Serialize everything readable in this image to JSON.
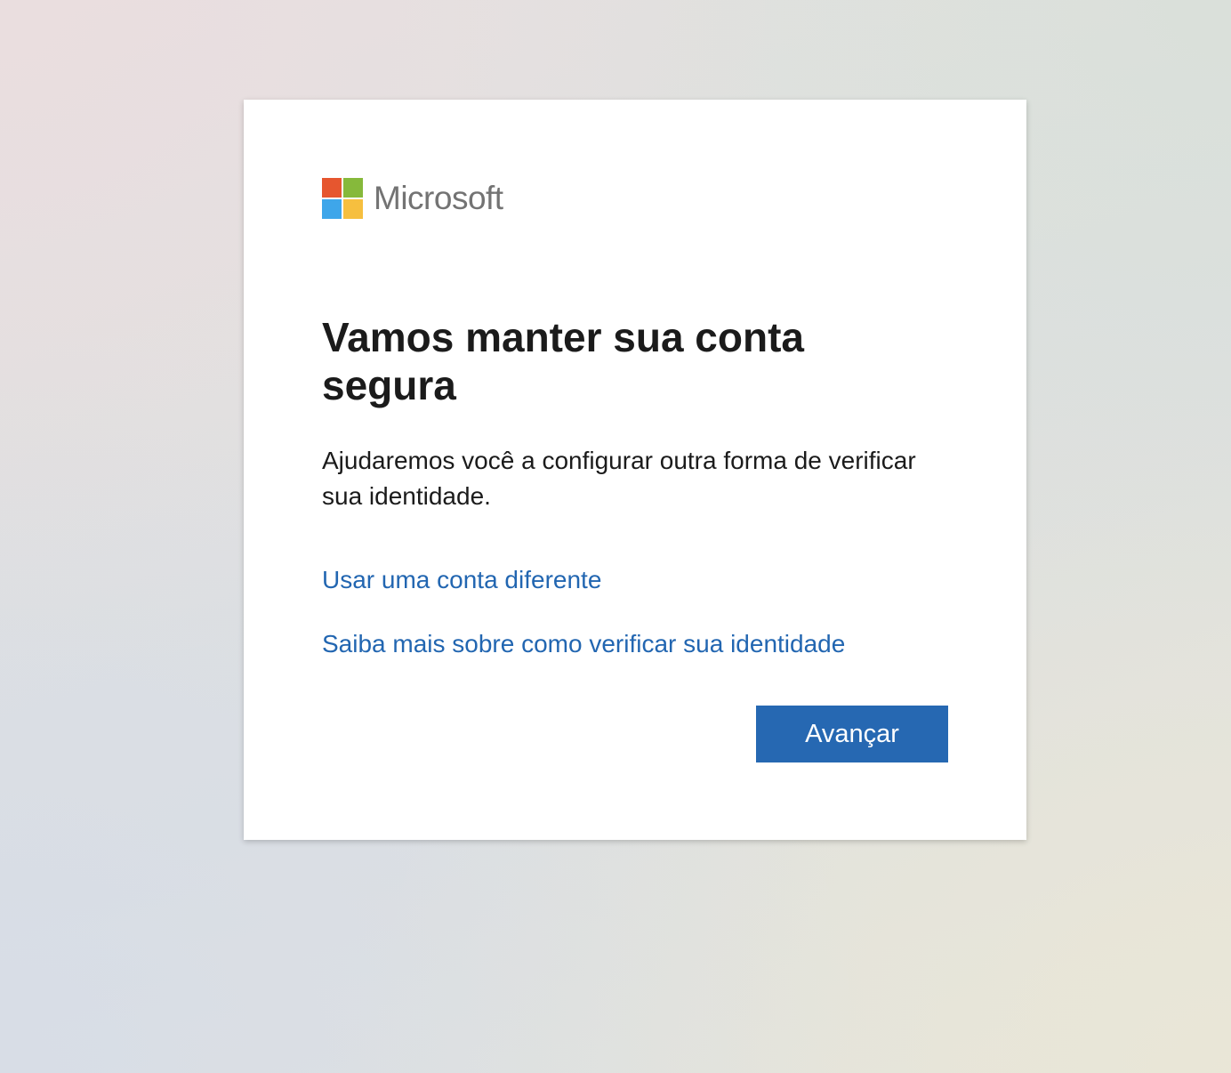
{
  "logo": {
    "text": "Microsoft",
    "colors": {
      "red": "#f25022",
      "green": "#7fba00",
      "blue": "#00a4ef",
      "yellow": "#ffb900"
    }
  },
  "main": {
    "title": "Vamos manter sua conta segura",
    "description": "Ajudaremos você a configurar outra forma de verificar sua identidade.",
    "links": [
      {
        "label": "Usar uma conta diferente"
      },
      {
        "label": "Saiba mais sobre como verificar sua identidade"
      }
    ],
    "next_button_label": "Avançar"
  },
  "colors": {
    "link": "#2266b1",
    "button": "#2668b2",
    "text": "#1b1b1b"
  }
}
